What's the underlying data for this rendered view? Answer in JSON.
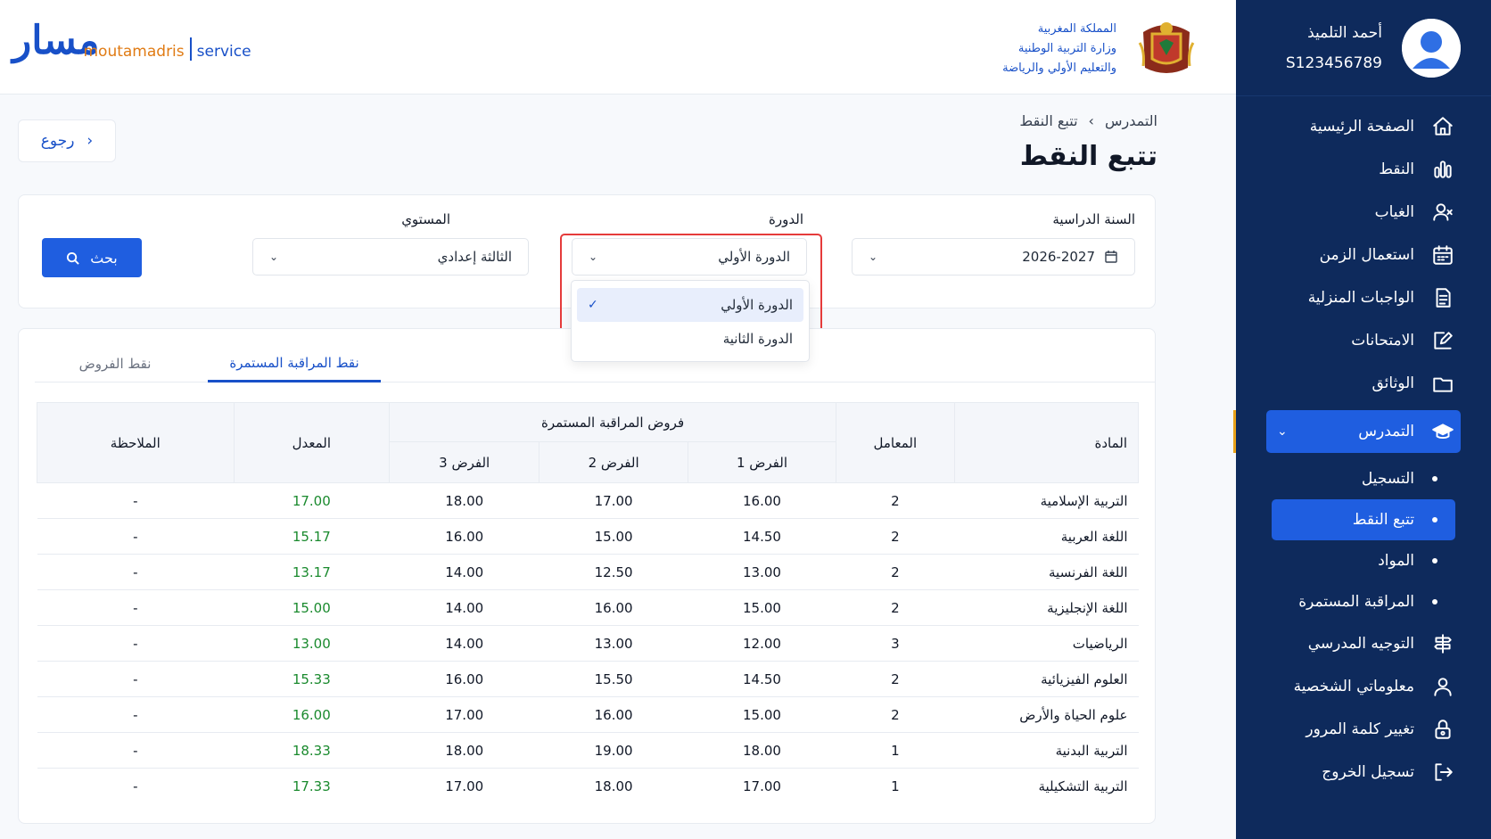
{
  "header": {
    "logo_ar": "مسار",
    "logo_brand": "moutamadris",
    "logo_service": "service",
    "ministry_lines": [
      "المملكة المغربية",
      "وزارة التربية الوطنية",
      "والتعليم الأولي والرياضة"
    ]
  },
  "user": {
    "name": "أحمد التلميذ",
    "id": "S123456789"
  },
  "sidebar": {
    "items": [
      {
        "label": "الصفحة الرئيسية",
        "icon": "home-icon"
      },
      {
        "label": "النقط",
        "icon": "chart-icon"
      },
      {
        "label": "الغياب",
        "icon": "user-x-icon"
      },
      {
        "label": "استعمال الزمن",
        "icon": "calendar-icon"
      },
      {
        "label": "الواجبات المنزلية",
        "icon": "document-icon"
      },
      {
        "label": "الامتحانات",
        "icon": "edit-icon"
      },
      {
        "label": "الوثائق",
        "icon": "folder-icon"
      }
    ],
    "active_group": {
      "label": "التمدرس",
      "icon": "graduation-cap-icon"
    },
    "sub_items": [
      "التسجيل",
      "تتبع النقط",
      "المواد",
      "المراقبة المستمرة"
    ],
    "bottom_items": [
      {
        "label": "التوجيه المدرسي",
        "icon": "signpost-icon"
      },
      {
        "label": "معلوماتي الشخصية",
        "icon": "person-icon"
      },
      {
        "label": "تغيير كلمة المرور",
        "icon": "lock-icon"
      },
      {
        "label": "تسجيل الخروج",
        "icon": "logout-icon"
      }
    ]
  },
  "back_label": "رجوع",
  "breadcrumb": {
    "parent": "التمدرس",
    "separator": "›",
    "current": "تتبع النقط"
  },
  "page_title": "تتبع النقط",
  "filters": {
    "year_label": "السنة الدراسية",
    "year_value": "2026-2027",
    "term_label": "الدورة",
    "term_value": "الدورة الأولي",
    "level_label": "المستوي",
    "level_value": "الثالثة إعدادي",
    "search_label": "بحث",
    "term_options": [
      "الدورة الأولي",
      "الدورة الثانية"
    ]
  },
  "tabs": {
    "active": "نقط المراقبة المستمرة",
    "other": "نقط الفروض"
  },
  "table": {
    "headers": {
      "subject": "المادة",
      "coef": "المعامل",
      "group": "فروض المراقبة المستمرة",
      "t1": "الفرض 1",
      "t2": "الفرض 2",
      "t3": "الفرض 3",
      "avg": "المعدل",
      "note": "الملاحظة"
    },
    "rows": [
      {
        "subject": "التربية الإسلامية",
        "coef": "2",
        "t1": "16.00",
        "t2": "17.00",
        "t3": "18.00",
        "avg": "17.00",
        "note": "-"
      },
      {
        "subject": "اللغة العربية",
        "coef": "2",
        "t1": "14.50",
        "t2": "15.00",
        "t3": "16.00",
        "avg": "15.17",
        "note": "-"
      },
      {
        "subject": "اللغة الفرنسية",
        "coef": "2",
        "t1": "13.00",
        "t2": "12.50",
        "t3": "14.00",
        "avg": "13.17",
        "note": "-"
      },
      {
        "subject": "اللغة الإنجليزية",
        "coef": "2",
        "t1": "15.00",
        "t2": "16.00",
        "t3": "14.00",
        "avg": "15.00",
        "note": "-"
      },
      {
        "subject": "الرياضيات",
        "coef": "3",
        "t1": "12.00",
        "t2": "13.00",
        "t3": "14.00",
        "avg": "13.00",
        "note": "-"
      },
      {
        "subject": "العلوم الفيزيائية",
        "coef": "2",
        "t1": "14.50",
        "t2": "15.50",
        "t3": "16.00",
        "avg": "15.33",
        "note": "-"
      },
      {
        "subject": "علوم الحياة والأرض",
        "coef": "2",
        "t1": "15.00",
        "t2": "16.00",
        "t3": "17.00",
        "avg": "16.00",
        "note": "-"
      },
      {
        "subject": "التربية البدنية",
        "coef": "1",
        "t1": "18.00",
        "t2": "19.00",
        "t3": "18.00",
        "avg": "18.33",
        "note": "-"
      },
      {
        "subject": "التربية التشكيلية",
        "coef": "1",
        "t1": "17.00",
        "t2": "18.00",
        "t3": "17.00",
        "avg": "17.33",
        "note": "-"
      }
    ]
  },
  "colors": {
    "sidebar": "#0e2a5c",
    "accent": "#1f5ee0",
    "avg_green": "#1a8a2e",
    "highlight": "#e53b3b"
  }
}
